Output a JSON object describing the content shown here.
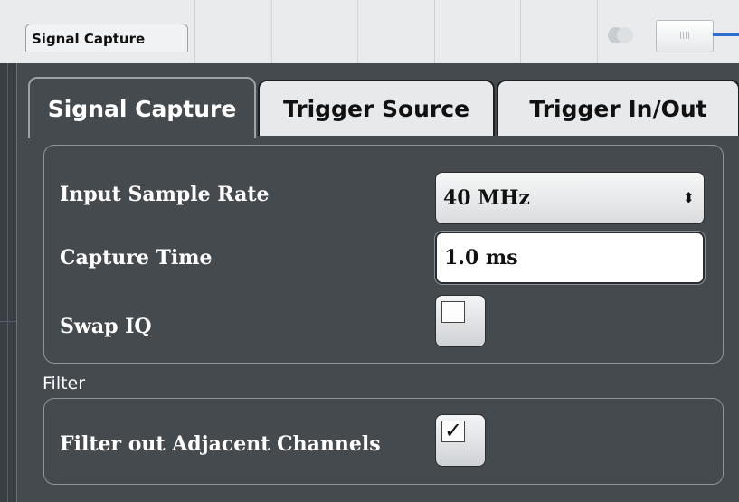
{
  "window": {
    "title": "Signal Capture"
  },
  "tabs": [
    {
      "label": "Signal Capture",
      "active": true
    },
    {
      "label": "Trigger Source",
      "active": false
    },
    {
      "label": "Trigger In/Out",
      "active": false
    }
  ],
  "settings": {
    "sample_rate_label": "Input Sample Rate",
    "sample_rate_value": "40 MHz",
    "capture_time_label": "Capture Time",
    "capture_time_value": "1.0 ms",
    "swap_iq_label": "Swap IQ",
    "swap_iq_checked": false
  },
  "filter": {
    "section_label": "Filter",
    "adjacent_label": "Filter out Adjacent Channels",
    "adjacent_checked": true
  },
  "colors": {
    "dialog_bg": "#454a4e",
    "accent_line": "#2d6fd1"
  },
  "icons": {
    "select_arrows": "up-down-arrows-icon",
    "checkmark": "checkmark-icon"
  }
}
